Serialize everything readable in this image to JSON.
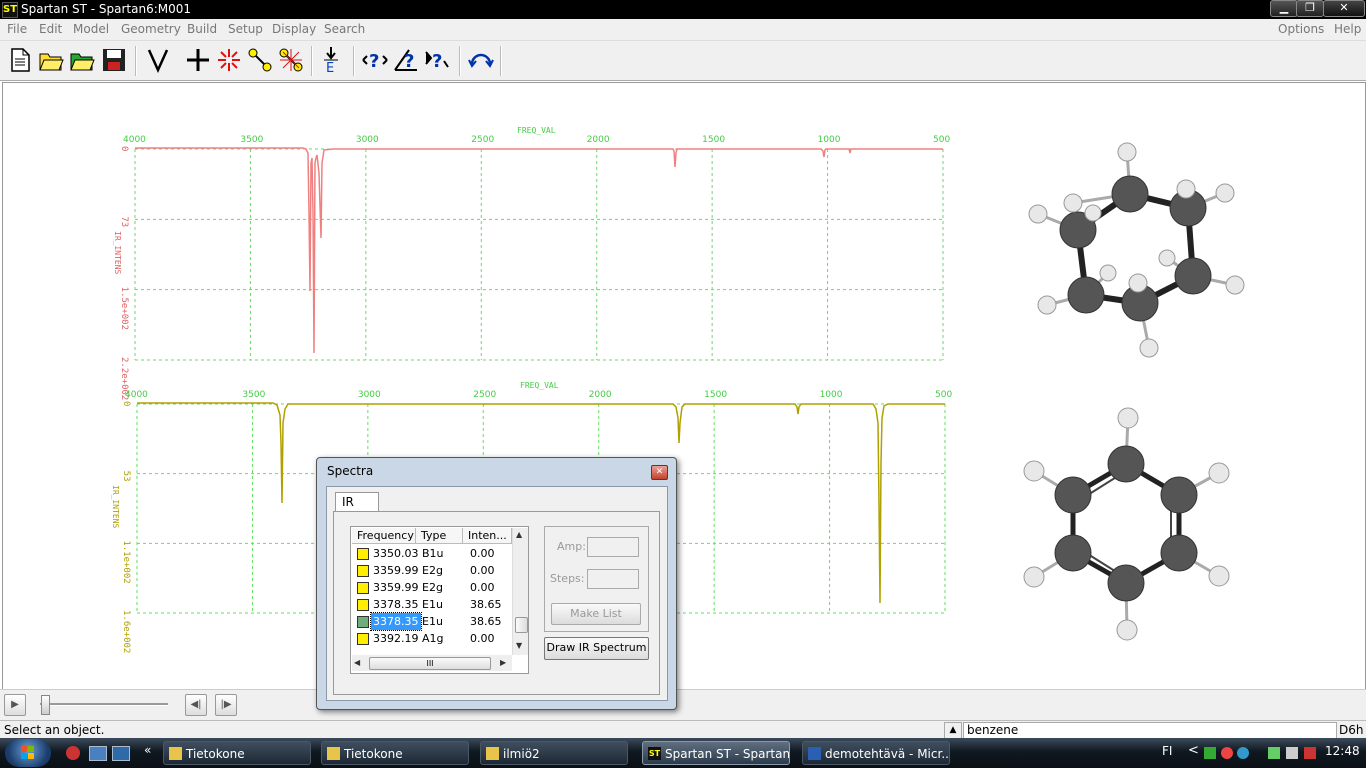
{
  "window": {
    "title": "Spartan ST - Spartan6:M001",
    "logo_text": "ST"
  },
  "menu": {
    "left": [
      "File",
      "Edit",
      "Model",
      "Geometry",
      "Build",
      "Setup",
      "Display",
      "Search"
    ],
    "right": [
      "Options",
      "Help"
    ]
  },
  "toolbar": {
    "icons": [
      "new-file-icon",
      "open-folder-icon",
      "open-folder-green-icon",
      "save-icon",
      "view-mode-icon",
      "add-fragment-icon",
      "delete-icon",
      "make-bond-icon",
      "break-bond-icon",
      "minimize-energy-icon",
      "measure-distance-icon",
      "measure-angle-icon",
      "measure-dihedral-icon",
      "undo-arrow-icon"
    ]
  },
  "plots": {
    "top": {
      "x_title": "FREQ_VAL",
      "y_title": "IR_INTENS",
      "x_ticks": [
        "4000",
        "3500",
        "3000",
        "2500",
        "2000",
        "1500",
        "1000",
        "500"
      ],
      "y_ticks": [
        "0",
        "73",
        "1.5e+002",
        "2.2e+002"
      ],
      "color": "#f08080"
    },
    "bottom": {
      "x_title": "FREQ_VAL",
      "y_title": "IR_INTENS",
      "x_ticks": [
        "4000",
        "3500",
        "3000",
        "2500",
        "2000",
        "1500",
        "1000",
        "500"
      ],
      "y_ticks": [
        "0",
        "53",
        "1.1e+002",
        "1.6e+002"
      ],
      "color": "#b0a000"
    }
  },
  "dialog": {
    "title": "Spectra",
    "tab": "IR",
    "columns": [
      "Frequency",
      "Type",
      "Inten..."
    ],
    "rows": [
      {
        "freq": "3350.03",
        "type": "B1u",
        "inten": "0.00",
        "selected": false
      },
      {
        "freq": "3359.99",
        "type": "E2g",
        "inten": "0.00",
        "selected": false
      },
      {
        "freq": "3359.99",
        "type": "E2g",
        "inten": "0.00",
        "selected": false
      },
      {
        "freq": "3378.35",
        "type": "E1u",
        "inten": "38.65",
        "selected": false
      },
      {
        "freq": "3378.35",
        "type": "E1u",
        "inten": "38.65",
        "selected": true
      },
      {
        "freq": "3392.19",
        "type": "A1g",
        "inten": "0.00",
        "selected": false
      }
    ],
    "amp_label": "Amp:",
    "steps_label": "Steps:",
    "make_list_label": "Make List",
    "draw_ir_label": "Draw IR Spectrum",
    "hscroll_thumb": "III"
  },
  "status": {
    "message": "Select an object.",
    "molecule": "benzene",
    "symmetry": "D6h"
  },
  "taskbar": {
    "tasks": [
      {
        "label": "Tietokone",
        "active": false
      },
      {
        "label": "Tietokone",
        "active": false
      },
      {
        "label": "ilmiö2",
        "active": false
      },
      {
        "label": "Spartan ST - Spartan...",
        "active": true
      },
      {
        "label": "demotehtävä - Micr...",
        "active": false
      }
    ],
    "lang": "FI",
    "clock": "12:48",
    "chevron": "«",
    "tray_chevron": "<"
  },
  "colors": {
    "grid": "#66dd66",
    "top_spectrum": "#f08080",
    "bottom_spectrum": "#b0a000",
    "selected_row": "#3399ff"
  }
}
